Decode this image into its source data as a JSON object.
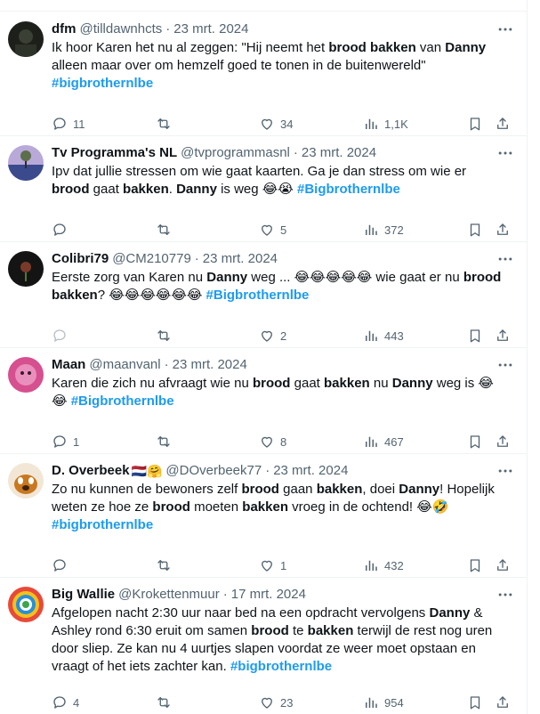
{
  "tweets": [
    {
      "name": "dfm",
      "handle": "@tilldawnhcts",
      "date": "23 mrt. 2024",
      "emoji": "",
      "lines": [
        [
          {
            "t": "Ik hoor Karen het nu al zeggen: \"Hij neemt het "
          },
          {
            "t": "brood",
            "b": true
          },
          {
            "t": " "
          },
          {
            "t": "bakken",
            "b": true
          },
          {
            "t": " van "
          },
          {
            "t": "Danny",
            "b": true
          }
        ],
        [
          {
            "t": "alleen maar over om hemzelf goed te tonen in de buitenwereld\""
          }
        ],
        [
          {
            "t": "#bigbrothernlbe",
            "h": true
          }
        ]
      ],
      "replies": "11",
      "retweets": "",
      "likes": "34",
      "views": "1,1K"
    },
    {
      "name": "Tv Programma's NL",
      "handle": "@tvprogrammasnl",
      "date": "23 mrt. 2024",
      "emoji": "",
      "lines": [
        [
          {
            "t": "Ipv dat jullie stressen om wie gaat kaarten. Ga je dan stress om wie er"
          }
        ],
        [
          {
            "t": "brood",
            "b": true
          },
          {
            "t": " gaat "
          },
          {
            "t": "bakken",
            "b": true
          },
          {
            "t": ". "
          },
          {
            "t": "Danny",
            "b": true
          },
          {
            "t": " is weg 😂😭 "
          },
          {
            "t": "#Bigbrothernlbe",
            "h": true
          }
        ]
      ],
      "replies": "",
      "retweets": "",
      "likes": "5",
      "views": "372"
    },
    {
      "name": "Colibri79",
      "handle": "@CM210779",
      "date": "23 mrt. 2024",
      "emoji": "",
      "lines": [
        [
          {
            "t": "Eerste zorg van Karen nu "
          },
          {
            "t": "Danny",
            "b": true
          },
          {
            "t": " weg ... 😂😂😂😂😂 wie gaat er nu "
          },
          {
            "t": "brood",
            "b": true
          }
        ],
        [
          {
            "t": "bakken",
            "b": true
          },
          {
            "t": "? 😂😂😂😂😂😂 "
          },
          {
            "t": "#Bigbrothernlbe",
            "h": true
          }
        ]
      ],
      "replies": "",
      "retweets": "",
      "likes": "2",
      "views": "443"
    },
    {
      "name": "Maan",
      "handle": "@maanvanl",
      "date": "23 mrt. 2024",
      "emoji": "",
      "lines": [
        [
          {
            "t": "Karen die zich nu afvraagt wie nu "
          },
          {
            "t": "brood",
            "b": true
          },
          {
            "t": " gaat "
          },
          {
            "t": "bakken",
            "b": true
          },
          {
            "t": " nu "
          },
          {
            "t": "Danny",
            "b": true
          },
          {
            "t": " weg is 😂"
          }
        ],
        [
          {
            "t": "😂 "
          },
          {
            "t": "#Bigbrothernlbe",
            "h": true
          }
        ]
      ],
      "replies": "1",
      "retweets": "",
      "likes": "8",
      "views": "467"
    },
    {
      "name": "D. Overbeek",
      "handle": "@DOverbeek77",
      "date": "23 mrt. 2024",
      "emoji": "🇳🇱🤗",
      "lines": [
        [
          {
            "t": "Zo nu kunnen de bewoners zelf "
          },
          {
            "t": "brood",
            "b": true
          },
          {
            "t": " gaan "
          },
          {
            "t": "bakken",
            "b": true
          },
          {
            "t": ", doei "
          },
          {
            "t": "Danny",
            "b": true
          },
          {
            "t": "! Hopelijk"
          }
        ],
        [
          {
            "t": "weten ze hoe ze "
          },
          {
            "t": "brood",
            "b": true
          },
          {
            "t": " moeten "
          },
          {
            "t": "bakken",
            "b": true
          },
          {
            "t": " vroeg in de ochtend! 😂🤣"
          }
        ],
        [
          {
            "t": "#bigbrothernlbe",
            "h": true
          }
        ]
      ],
      "replies": "",
      "retweets": "",
      "likes": "1",
      "views": "432"
    },
    {
      "name": "Big Wallie",
      "handle": "@Krokettenmuur",
      "date": "17 mrt. 2024",
      "emoji": "",
      "lines": [
        [
          {
            "t": "Afgelopen nacht 2:30 uur naar bed na een opdracht vervolgens "
          },
          {
            "t": "Danny",
            "b": true
          },
          {
            "t": " &"
          }
        ],
        [
          {
            "t": "Ashley rond 6:30 eruit om samen "
          },
          {
            "t": "brood",
            "b": true
          },
          {
            "t": " te "
          },
          {
            "t": "bakken",
            "b": true
          },
          {
            "t": " terwijl de rest nog uren"
          }
        ],
        [
          {
            "t": "door sliep. Ze kan nu 4 uurtjes slapen voordat ze weer moet opstaan en"
          }
        ],
        [
          {
            "t": "vraagt of het iets zachter kan.  "
          },
          {
            "t": "#bigbrothernlbe",
            "h": true
          }
        ]
      ],
      "replies": "4",
      "retweets": "",
      "likes": "23",
      "views": "954"
    }
  ]
}
